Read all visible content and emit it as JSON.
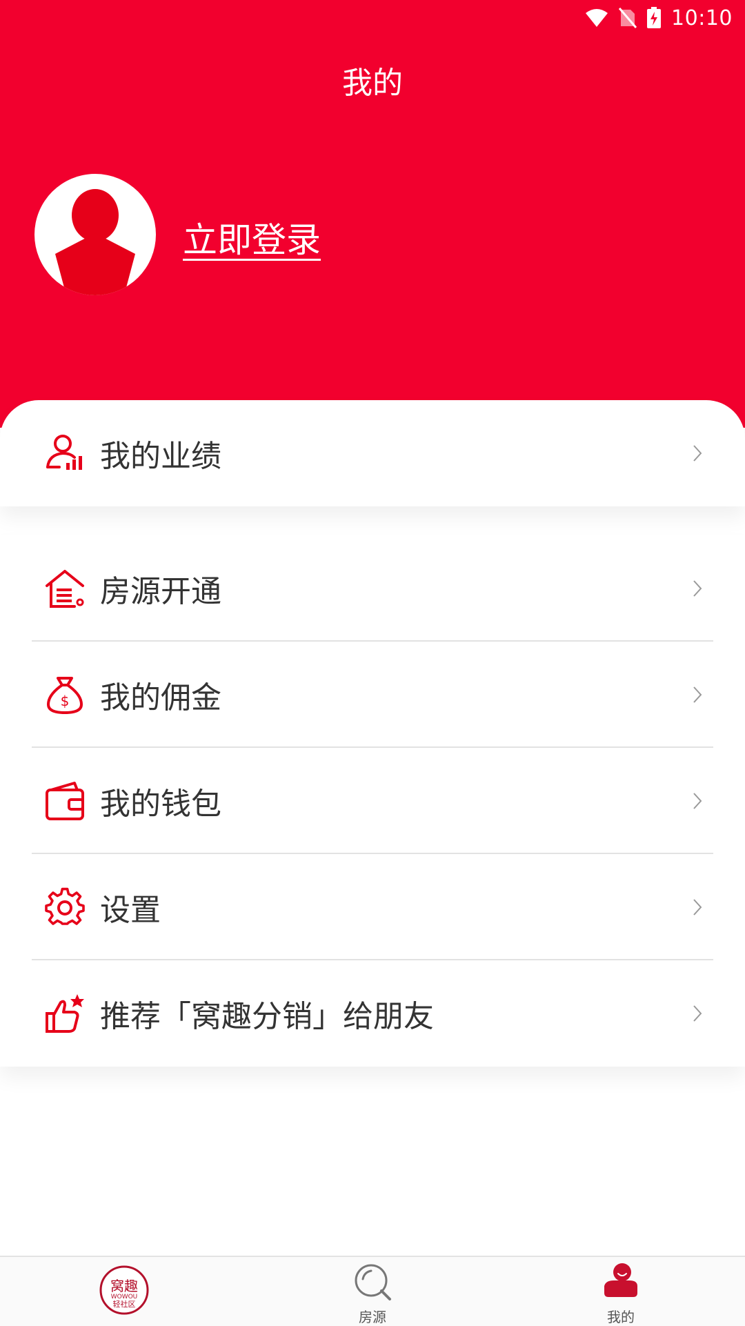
{
  "statusbar": {
    "time": "10:10"
  },
  "header": {
    "title": "我的",
    "login_text": "立即登录"
  },
  "menu": {
    "performance": "我的业绩",
    "items": [
      {
        "label": "房源开通"
      },
      {
        "label": "我的佣金"
      },
      {
        "label": "我的钱包"
      },
      {
        "label": "设置"
      },
      {
        "label": "推荐「窝趣分销」给朋友"
      }
    ]
  },
  "tabbar": {
    "tabs": [
      {
        "label": ""
      },
      {
        "label": "房源"
      },
      {
        "label": "我的"
      }
    ]
  },
  "logo": {
    "line1": "窝趣",
    "line2": "WOWOU",
    "line3": "轻社区"
  },
  "colors": {
    "accent": "#f2002e",
    "text": "#333333"
  }
}
